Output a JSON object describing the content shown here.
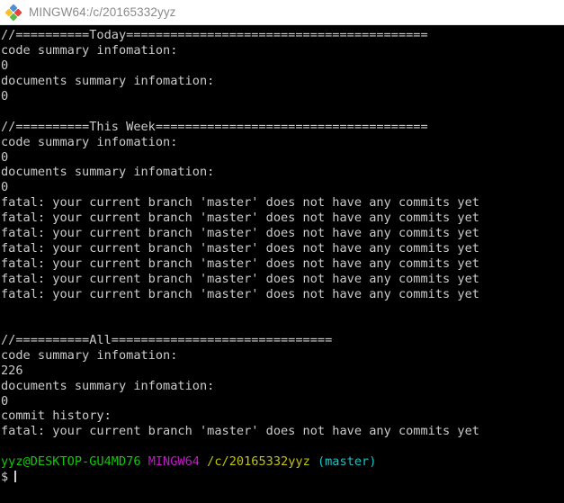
{
  "window": {
    "title": "MINGW64:/c/20165332yyz",
    "icon": "mintty-diamond-icon",
    "background_color": "#000000",
    "titlebar_color": "#ffffff",
    "text_color": "#cccccc"
  },
  "terminal": {
    "lines": [
      {
        "id": "today-header",
        "text": "//==========Today========================================="
      },
      {
        "id": "today-code-label",
        "text": "code summary infomation:"
      },
      {
        "id": "today-code-value",
        "text": "0"
      },
      {
        "id": "today-docs-label",
        "text": "documents summary infomation:"
      },
      {
        "id": "today-docs-value",
        "text": "0"
      },
      {
        "id": "blank-1",
        "text": " "
      },
      {
        "id": "week-header",
        "text": "//==========This Week====================================="
      },
      {
        "id": "week-code-label",
        "text": "code summary infomation:"
      },
      {
        "id": "week-code-value",
        "text": "0"
      },
      {
        "id": "week-docs-label",
        "text": "documents summary infomation:"
      },
      {
        "id": "week-docs-value",
        "text": "0"
      },
      {
        "id": "fatal-1",
        "text": "fatal: your current branch 'master' does not have any commits yet"
      },
      {
        "id": "fatal-2",
        "text": "fatal: your current branch 'master' does not have any commits yet"
      },
      {
        "id": "fatal-3",
        "text": "fatal: your current branch 'master' does not have any commits yet"
      },
      {
        "id": "fatal-4",
        "text": "fatal: your current branch 'master' does not have any commits yet"
      },
      {
        "id": "fatal-5",
        "text": "fatal: your current branch 'master' does not have any commits yet"
      },
      {
        "id": "fatal-6",
        "text": "fatal: your current branch 'master' does not have any commits yet"
      },
      {
        "id": "fatal-7",
        "text": "fatal: your current branch 'master' does not have any commits yet"
      },
      {
        "id": "blank-2",
        "text": " "
      },
      {
        "id": "blank-3",
        "text": " "
      },
      {
        "id": "all-header",
        "text": "//==========All=============================="
      },
      {
        "id": "all-code-label",
        "text": "code summary infomation:"
      },
      {
        "id": "all-code-value",
        "text": "226"
      },
      {
        "id": "all-docs-label",
        "text": "documents summary infomation:"
      },
      {
        "id": "all-docs-value",
        "text": "0"
      },
      {
        "id": "commit-history-label",
        "text": "commit history:"
      },
      {
        "id": "fatal-8",
        "text": "fatal: your current branch 'master' does not have any commits yet"
      },
      {
        "id": "blank-4",
        "text": " "
      }
    ],
    "prompt": {
      "user_host": "yyz@DESKTOP-GU4MD76",
      "shell": "MINGW64",
      "path": "/c/20165332yyz",
      "branch": "(master)",
      "symbol": "$",
      "colors": {
        "user_host": "#16c60c",
        "shell": "#c21ac7",
        "path": "#c5c500",
        "branch": "#18c4c4",
        "symbol": "#cccccc"
      }
    }
  }
}
